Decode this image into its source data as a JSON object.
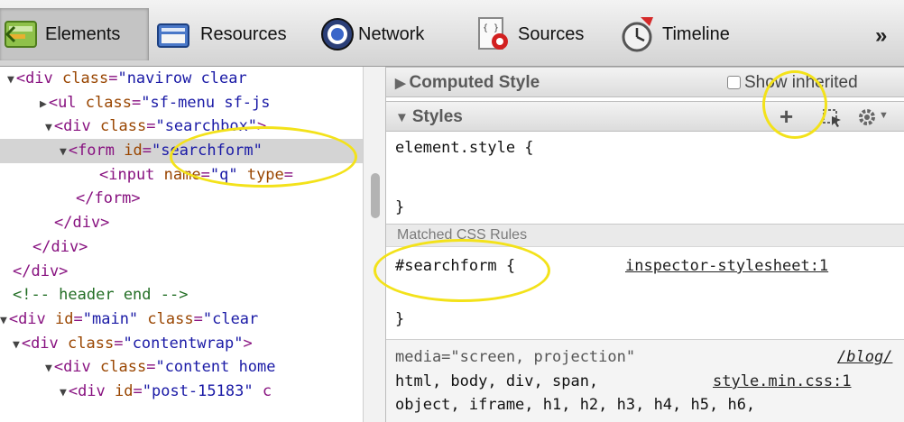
{
  "toolbar": {
    "tabs": [
      {
        "label": "Elements",
        "icon": "elements-icon",
        "active": true
      },
      {
        "label": "Resources",
        "icon": "resources-icon",
        "active": false
      },
      {
        "label": "Network",
        "icon": "network-icon",
        "active": false
      },
      {
        "label": "Sources",
        "icon": "sources-icon",
        "active": false
      },
      {
        "label": "Timeline",
        "icon": "timeline-icon",
        "active": false
      }
    ],
    "more_label": "»"
  },
  "dom_tree": [
    {
      "tri": "▼",
      "parts": [
        [
          "t",
          "<div "
        ],
        [
          "a",
          "class"
        ],
        [
          "t",
          "="
        ],
        [
          "v",
          "\"navirow clear"
        ]
      ],
      "selected": false
    },
    {
      "tri": "▶",
      "parts": [
        [
          "t",
          "<ul "
        ],
        [
          "a",
          "class"
        ],
        [
          "t",
          "="
        ],
        [
          "v",
          "\"sf-menu sf-js"
        ]
      ],
      "selected": false
    },
    {
      "tri": "▼",
      "parts": [
        [
          "t",
          "<div "
        ],
        [
          "a",
          "class"
        ],
        [
          "t",
          "="
        ],
        [
          "v",
          "\"searchbox\""
        ],
        [
          "t",
          ">"
        ]
      ],
      "selected": false
    },
    {
      "tri": "▼",
      "parts": [
        [
          "t",
          "<form "
        ],
        [
          "a",
          "id"
        ],
        [
          "t",
          "="
        ],
        [
          "v",
          "\"searchform\""
        ]
      ],
      "selected": true
    },
    {
      "tri": "",
      "parts": [
        [
          "t",
          "<input "
        ],
        [
          "a",
          "name"
        ],
        [
          "t",
          "="
        ],
        [
          "v",
          "\"q\""
        ],
        [
          "t",
          " "
        ],
        [
          "a",
          "type"
        ],
        [
          "t",
          "="
        ]
      ],
      "selected": false
    },
    {
      "tri": "",
      "parts": [
        [
          "t",
          "</form>"
        ]
      ],
      "selected": false
    },
    {
      "tri": "",
      "parts": [
        [
          "t",
          "</div>"
        ]
      ],
      "selected": false
    },
    {
      "tri": "",
      "parts": [
        [
          "t",
          "</div>"
        ]
      ],
      "selected": false
    },
    {
      "tri": "",
      "parts": [
        [
          "t",
          "</div>"
        ]
      ],
      "selected": false
    },
    {
      "tri": "",
      "parts": [
        [
          "c",
          "<!-- header end -->"
        ]
      ],
      "selected": false
    },
    {
      "tri": "▼",
      "parts": [
        [
          "t",
          "<div "
        ],
        [
          "a",
          "id"
        ],
        [
          "t",
          "="
        ],
        [
          "v",
          "\"main\""
        ],
        [
          "t",
          " "
        ],
        [
          "a",
          "class"
        ],
        [
          "t",
          "="
        ],
        [
          "v",
          "\"clear"
        ]
      ],
      "selected": false
    },
    {
      "tri": "▼",
      "parts": [
        [
          "t",
          "<div "
        ],
        [
          "a",
          "class"
        ],
        [
          "t",
          "="
        ],
        [
          "v",
          "\"contentwrap\""
        ],
        [
          "t",
          ">"
        ]
      ],
      "selected": false
    },
    {
      "tri": "▼",
      "parts": [
        [
          "t",
          "<div "
        ],
        [
          "a",
          "class"
        ],
        [
          "t",
          "="
        ],
        [
          "v",
          "\"content home"
        ]
      ],
      "selected": false
    },
    {
      "tri": "▼",
      "parts": [
        [
          "t",
          "<div "
        ],
        [
          "a",
          "id"
        ],
        [
          "t",
          "="
        ],
        [
          "v",
          "\"post-15183\""
        ],
        [
          "t",
          " c"
        ]
      ],
      "selected": false
    }
  ],
  "styles_pane": {
    "computed_style_title": "Computed Style",
    "show_inherited_label": "Show inherited",
    "styles_title": "Styles",
    "element_style_open": "element.style {",
    "element_style_close": "}",
    "matched_rules_title": "Matched CSS Rules",
    "rule_selector": "#searchform {",
    "rule_source": "inspector-stylesheet:1",
    "rule_close": "}",
    "media_line": "media=\"screen, projection\"",
    "media_source": "/blog/",
    "rule2_line1": "html, body, div, span,",
    "rule2_source": "style.min.css:1",
    "rule2_line2": "object, iframe, h1, h2, h3, h4, h5, h6,"
  },
  "highlight_color": "#f3e21a"
}
